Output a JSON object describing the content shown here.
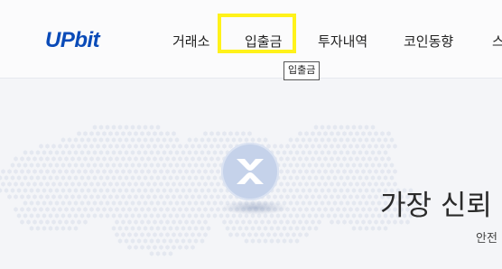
{
  "brand": {
    "logo_text": "UPbit",
    "color": "#0a4bb8"
  },
  "nav": {
    "items": [
      {
        "label": "거래소"
      },
      {
        "label": "입출금"
      },
      {
        "label": "투자내역"
      },
      {
        "label": "코인동향"
      },
      {
        "label": "스"
      }
    ],
    "highlighted": "입출금",
    "tooltip": "입출금"
  },
  "hero": {
    "coin_icon": "xrp-icon",
    "title": "가장 신뢰",
    "subtitle": "안전"
  },
  "colors": {
    "highlight": "#fff21a",
    "background": "#f4f5f8"
  }
}
